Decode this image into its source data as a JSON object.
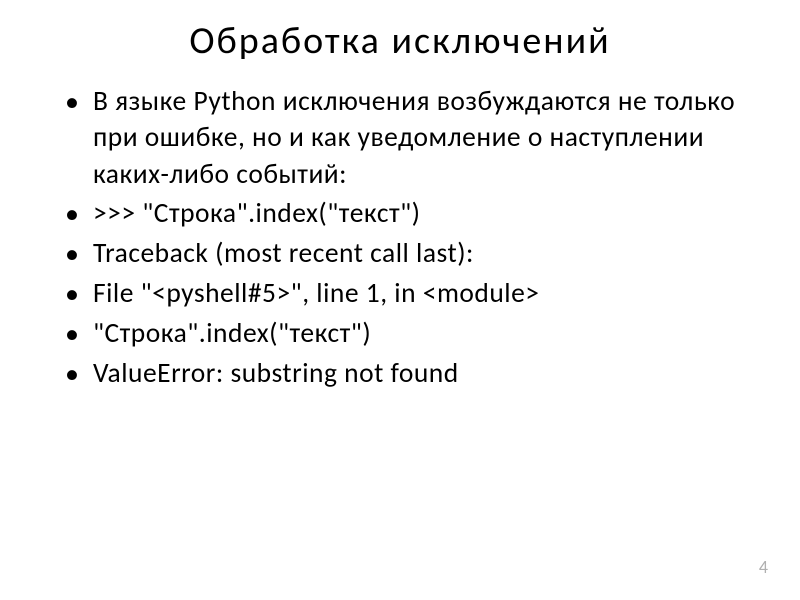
{
  "title": "Обработка  исключений",
  "bullets": [
    "В языке Python исключения возбуждаются не только  при  ошибке, но  и  как уведомление  о наступлении  каких-либо  событий:",
    ">>>  \"Строка\".index(\"текст\")",
    "Traceback  (most  recent  call  last):",
    "  File  \"<pyshell#5>\",  line  1,  in  <module>",
    "    \"Строка\".index(\"текст\")",
    "ValueError:  substring  not  found"
  ],
  "pageNumber": "4"
}
